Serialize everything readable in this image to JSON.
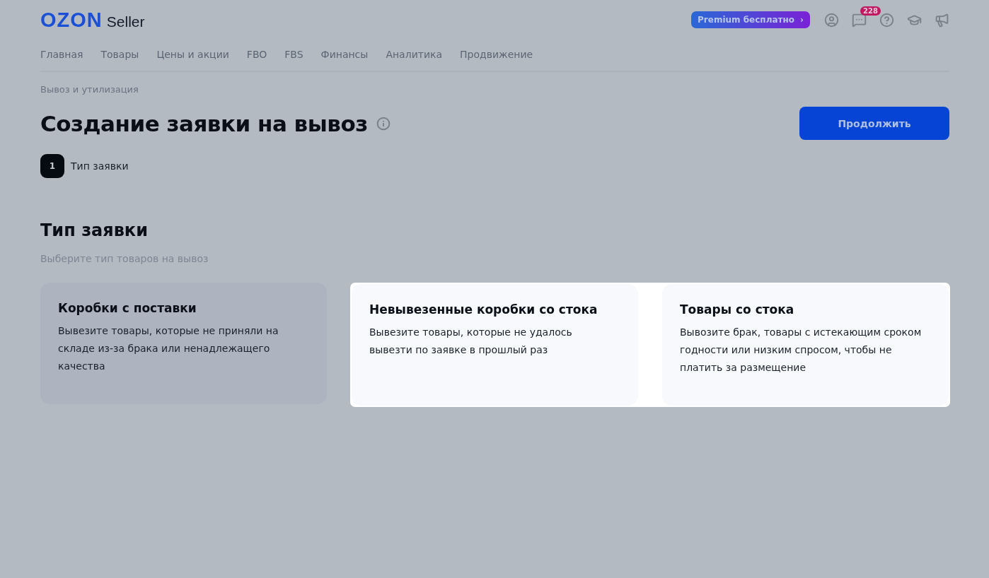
{
  "header": {
    "logo": "OZON",
    "product": "Seller",
    "premium": "Premium бесплатно",
    "premium_arrow": "›",
    "messages_count": "228"
  },
  "nav": [
    "Главная",
    "Товары",
    "Цены и акции",
    "FBO",
    "FBS",
    "Финансы",
    "Аналитика",
    "Продвижение"
  ],
  "breadcrumb": "Вывоз и утилизация",
  "title": "Создание заявки на вывоз",
  "continue_button": "Продолжить",
  "steps": [
    {
      "number": "1",
      "label": "Тип заявки"
    }
  ],
  "section": {
    "title": "Тип заявки",
    "subtitle": "Выберите тип товаров на вывоз"
  },
  "cards": [
    {
      "title": "Коробки с поставки",
      "text": "Вывезите товары, которые не приняли на складе из-за брака или ненадлежащего качества",
      "highlighted": false
    },
    {
      "title": "Невывезенные коробки со стока",
      "text": "Вывезите товары, которые не удалось вывезти по заявке в прошлый раз",
      "highlighted": true
    },
    {
      "title": "Товары со стока",
      "text": "Вывозите брак, товары с истекающим сроком годности или низким спросом, чтобы не платить за размещение",
      "highlighted": true
    }
  ]
}
